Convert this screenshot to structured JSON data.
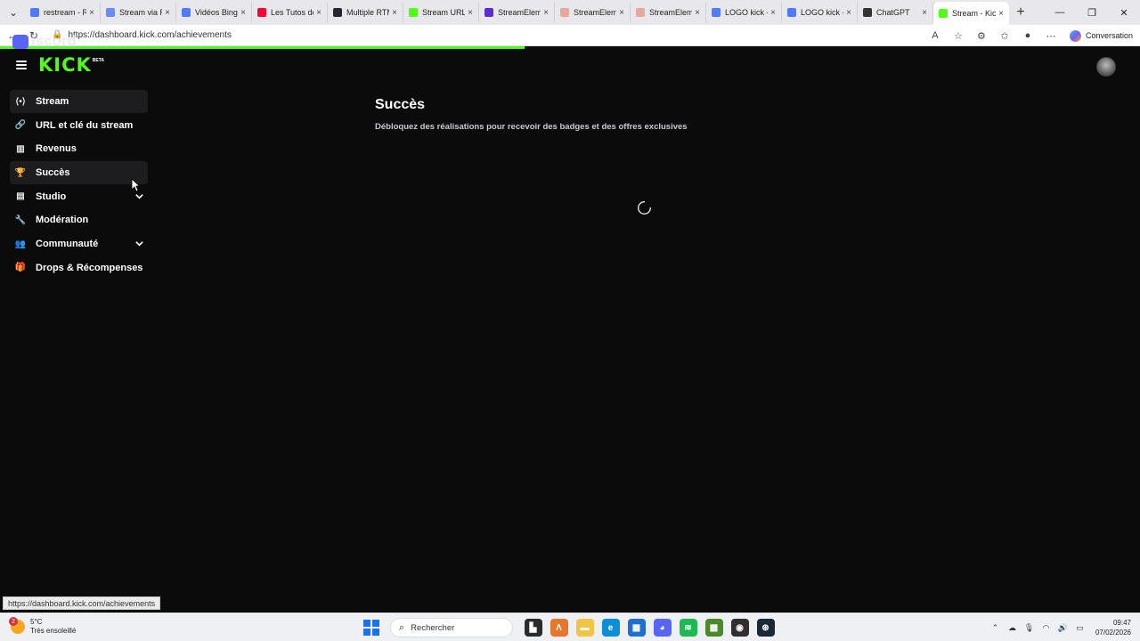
{
  "browser": {
    "tabs": [
      {
        "label": "restream - Re",
        "icon": "search-icon",
        "color": "#4f7cff"
      },
      {
        "label": "Stream via RT",
        "icon": "copilot-icon",
        "color": "#6b8cff"
      },
      {
        "label": "Vidéos Bing",
        "icon": "search-icon",
        "color": "#4f7cff"
      },
      {
        "label": "Les Tutos de",
        "icon": "youtube-icon",
        "color": "#ff0033"
      },
      {
        "label": "Multiple RTM",
        "icon": "github-icon",
        "color": "#24292f"
      },
      {
        "label": "Stream URL &",
        "icon": "kick-icon",
        "color": "#53fc18"
      },
      {
        "label": "StreamEleme",
        "icon": "twitch-icon",
        "color": "#5b2ecf"
      },
      {
        "label": "StreamEleme",
        "icon": "streamelements-icon",
        "color": "#e8a8a0"
      },
      {
        "label": "StreamEleme",
        "icon": "streamelements-icon",
        "color": "#e8a8a0"
      },
      {
        "label": "LOGO kick - F",
        "icon": "search-icon",
        "color": "#4f7cff"
      },
      {
        "label": "LOGO kick - F",
        "icon": "search-icon",
        "color": "#4f7cff"
      },
      {
        "label": "ChatGPT",
        "icon": "chatgpt-icon",
        "color": "#333333"
      },
      {
        "label": "Stream - Kick",
        "icon": "kick-icon",
        "color": "#53fc18",
        "active": true
      }
    ],
    "close_glyph": "×",
    "new_tab_glyph": "+",
    "url": "https://dashboard.kick.com/achievements",
    "copilot_label": "Conversation",
    "load_progress": 0.46
  },
  "overlay": {
    "discord_text": "iscord"
  },
  "kick": {
    "logo": "KICK",
    "beta": "BETA",
    "accent": "#53fc18"
  },
  "sidebar": {
    "items": [
      {
        "label": "Stream",
        "icon": "stream-icon",
        "glyph": "⟨•⟩",
        "highlight": true
      },
      {
        "label": "URL et clé du stream",
        "icon": "link-icon",
        "glyph": "🔗"
      },
      {
        "label": "Revenus",
        "icon": "chart-icon",
        "glyph": "▥"
      },
      {
        "label": "Succès",
        "icon": "trophy-icon",
        "glyph": "🏆",
        "highlight": true
      },
      {
        "label": "Studio",
        "icon": "studio-icon",
        "glyph": "▤",
        "expandable": true
      },
      {
        "label": "Modération",
        "icon": "wrench-icon",
        "glyph": "🔧"
      },
      {
        "label": "Communauté",
        "icon": "community-icon",
        "glyph": "👥",
        "expandable": true
      },
      {
        "label": "Drops & Récompenses",
        "icon": "drops-icon",
        "glyph": "🎁"
      }
    ]
  },
  "main": {
    "title": "Succès",
    "subtitle": "Débloquez des réalisations pour recevoir des badges et des offres exclusives"
  },
  "status_bar_url": "https://dashboard.kick.com/achievements",
  "taskbar": {
    "weather_badge": "2",
    "temperature": "5°C",
    "weather_desc": "Très ensoleillé",
    "search_placeholder": "Rechercher",
    "apps": [
      {
        "name": "taskview-icon",
        "color": "#2b2b2b",
        "glyph": "▙"
      },
      {
        "name": "app-a-icon",
        "color": "#e8772e",
        "glyph": "Λ"
      },
      {
        "name": "file-explorer-icon",
        "color": "#f3c443",
        "glyph": "▬"
      },
      {
        "name": "edge-icon",
        "color": "#0c8fd6",
        "glyph": "e"
      },
      {
        "name": "store-icon",
        "color": "#1f6fd0",
        "glyph": "▦"
      },
      {
        "name": "discord-icon",
        "color": "#5865f2",
        "glyph": "◕"
      },
      {
        "name": "spotify-icon",
        "color": "#1db954",
        "glyph": "≋"
      },
      {
        "name": "minecraft-icon",
        "color": "#4a8a2a",
        "glyph": "▩"
      },
      {
        "name": "obs-icon",
        "color": "#302e31",
        "glyph": "◉"
      },
      {
        "name": "steam-icon",
        "color": "#1b2838",
        "glyph": "⊛"
      }
    ],
    "time": "09:47",
    "date": "07/02/2026"
  }
}
